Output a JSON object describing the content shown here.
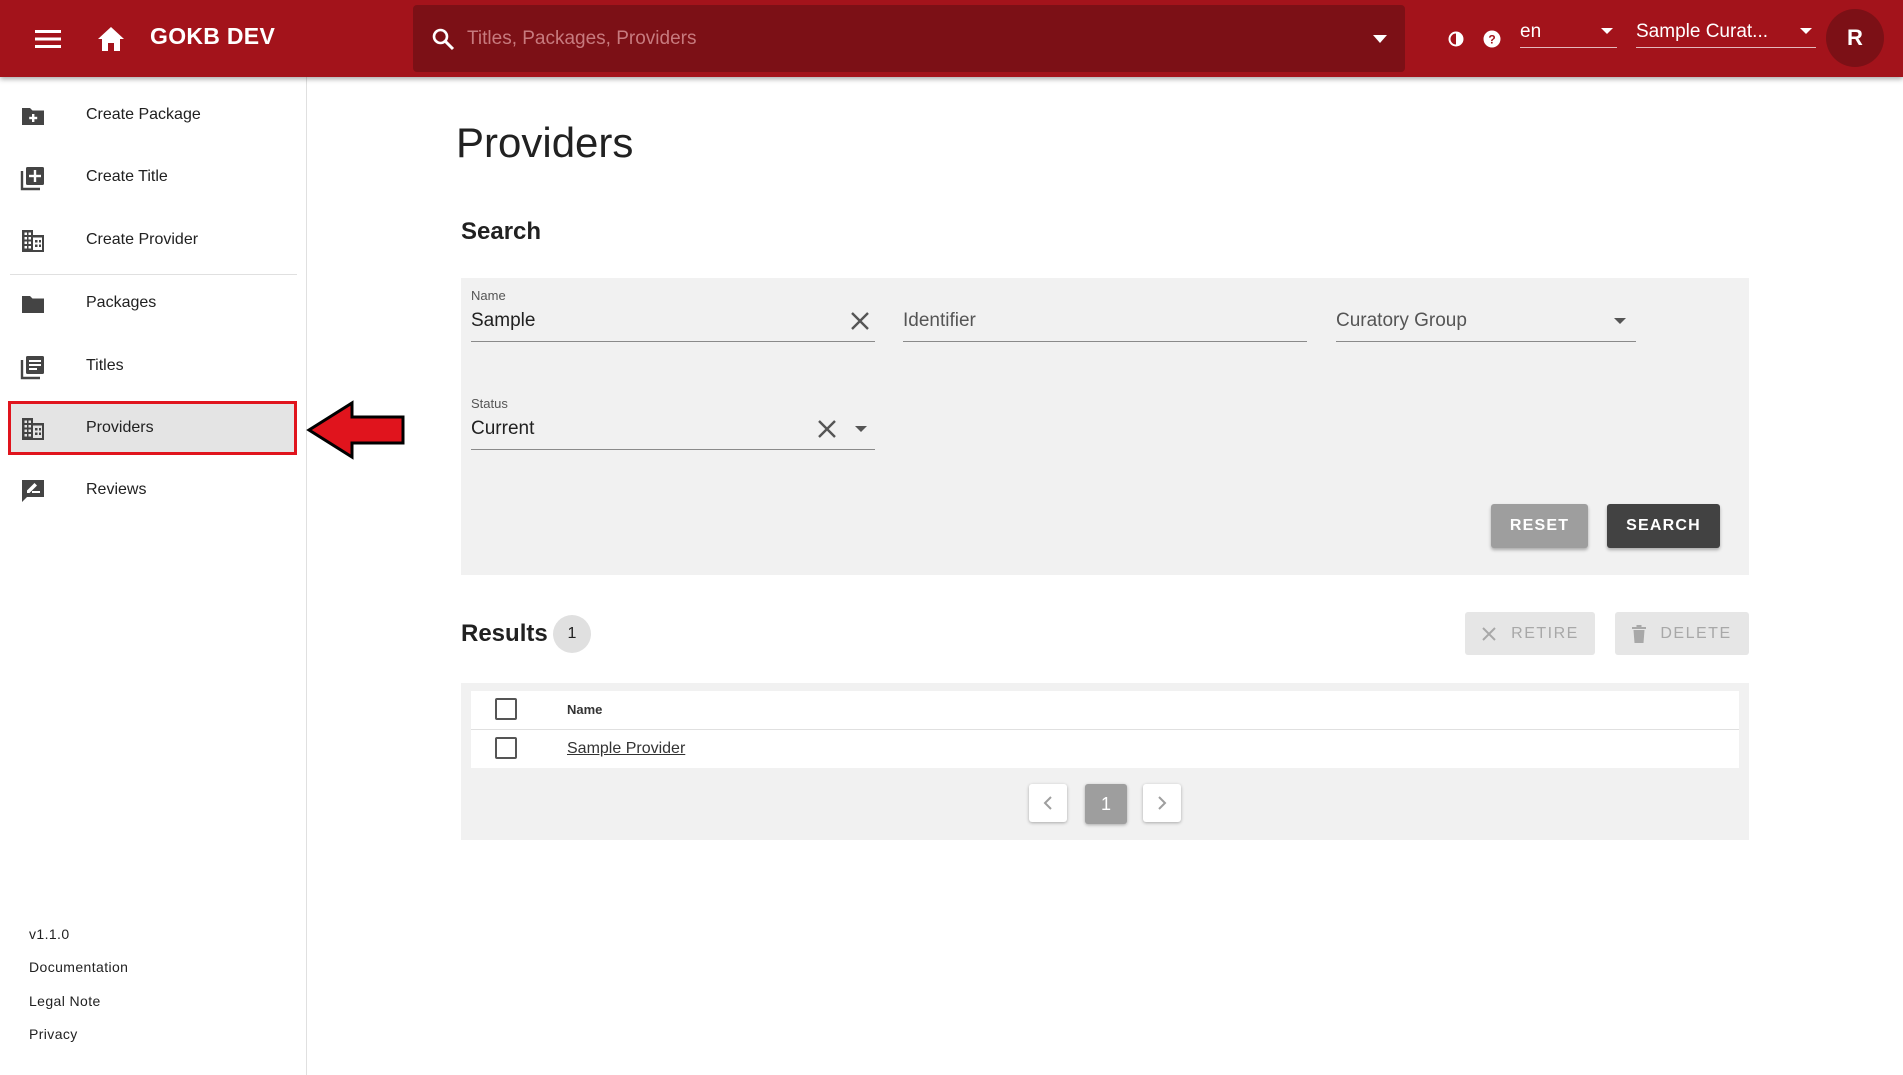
{
  "appbar": {
    "title": "GOKB DEV",
    "search_placeholder": "Titles, Packages, Providers",
    "language": "en",
    "user": "Sample Curat...",
    "avatar_initial": "R"
  },
  "sidebar": {
    "items": [
      {
        "label": "Create Package",
        "icon": "create-package-icon"
      },
      {
        "label": "Create Title",
        "icon": "library-add-icon"
      },
      {
        "label": "Create Provider",
        "icon": "domain-icon"
      },
      {
        "label": "Packages",
        "icon": "folder-icon"
      },
      {
        "label": "Titles",
        "icon": "library-books-icon"
      },
      {
        "label": "Providers",
        "icon": "domain-icon"
      },
      {
        "label": "Reviews",
        "icon": "rate-review-icon"
      }
    ],
    "active": "Providers",
    "footer": {
      "version": "v1.1.0",
      "documentation": "Documentation",
      "legal": "Legal Note",
      "privacy": "Privacy"
    }
  },
  "main": {
    "page_title": "Providers",
    "search": {
      "title": "Search",
      "name_label": "Name",
      "name_value": "Sample",
      "identifier_placeholder": "Identifier",
      "curatory_placeholder": "Curatory Group",
      "status_label": "Status",
      "status_value": "Current",
      "reset_label": "RESET",
      "search_label": "SEARCH"
    },
    "results": {
      "title": "Results",
      "count": "1",
      "retire_label": "RETIRE",
      "delete_label": "DELETE",
      "columns": [
        "Name"
      ],
      "rows": [
        {
          "name": "Sample Provider"
        }
      ],
      "current_page": "1"
    }
  },
  "colors": {
    "appbar": "#a3131b",
    "searchbar": "#7c1016",
    "highlight": "#e0141d"
  }
}
